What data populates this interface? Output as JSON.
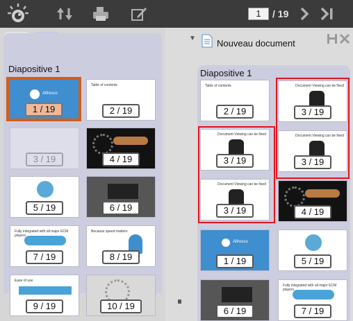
{
  "toolbar": {
    "current_page": "1",
    "total_pages": "/ 19",
    "icons": [
      "logo-eye-icon",
      "sort-arrows-icon",
      "print-icon",
      "edit-icon",
      "next-page-icon",
      "last-page-icon"
    ]
  },
  "left_panel": {
    "tabs": [
      "pages-tab-icon",
      "outline-tab-icon"
    ],
    "section_title": "Diapositive 1",
    "thumbs": [
      {
        "label": "1 / 19",
        "style": "selected"
      },
      {
        "label": "2 / 19",
        "style": "white"
      },
      {
        "label": "3 / 19",
        "style": "faded"
      },
      {
        "label": "4 / 19",
        "style": "dark"
      },
      {
        "label": "5 / 19",
        "style": "white"
      },
      {
        "label": "6 / 19",
        "style": "gray"
      },
      {
        "label": "7 / 19",
        "style": "white"
      },
      {
        "label": "8 / 19",
        "style": "white"
      },
      {
        "label": "9 / 19",
        "style": "white"
      },
      {
        "label": "10 / 19",
        "style": "gray"
      }
    ]
  },
  "right_panel": {
    "document_title": "Nouveau document",
    "section_title": "Diapositive 1",
    "thumbs": [
      {
        "label": "2 / 19",
        "style": "white"
      },
      {
        "label": "3 / 19",
        "style": "white"
      },
      {
        "label": "3 / 19",
        "style": "white"
      },
      {
        "label": "3 / 19",
        "style": "white"
      },
      {
        "label": "3 / 19",
        "style": "white"
      },
      {
        "label": "4 / 19",
        "style": "dark"
      },
      {
        "label": "1 / 19",
        "style": "blue"
      },
      {
        "label": "5 / 19",
        "style": "white"
      },
      {
        "label": "6 / 19",
        "style": "gray"
      },
      {
        "label": "7 / 19",
        "style": "white"
      }
    ]
  },
  "colors": {
    "toolbar_bg": "#3b3b3b",
    "panel_bg": "#cdcde0",
    "selection_border": "#d45d18",
    "highlight_red": "#e3131d"
  }
}
